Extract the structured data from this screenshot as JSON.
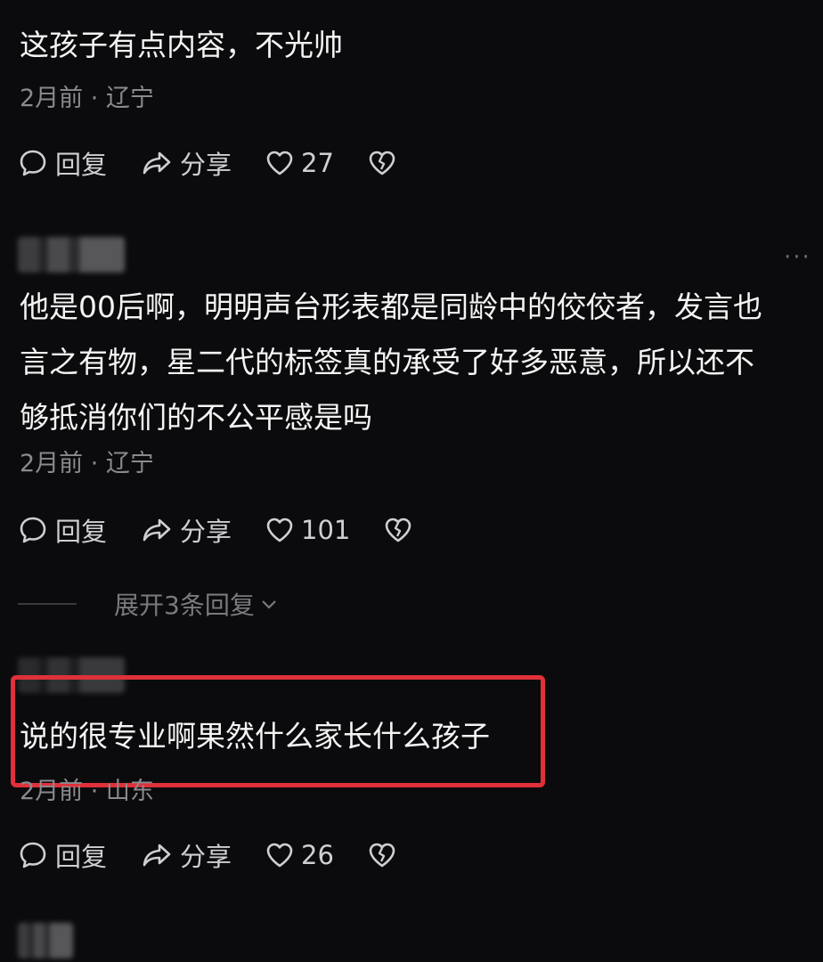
{
  "comments": [
    {
      "text_lines": [
        "这孩子有点内容，不光帅"
      ],
      "meta": "2月前 · 辽宁",
      "reply_label": "回复",
      "share_label": "分享",
      "likes": "27"
    },
    {
      "text_lines": [
        "他是00后啊，明明声台形表都是同龄中的佼佼者，发言也",
        "言之有物，星二代的标签真的承受了好多恶意，所以还不",
        "够抵消你们的不公平感是吗"
      ],
      "meta": "2月前 · 辽宁",
      "reply_label": "回复",
      "share_label": "分享",
      "likes": "101",
      "expand_label": "展开3条回复"
    },
    {
      "text_lines": [
        "说的很专业啊果然什么家长什么孩子"
      ],
      "meta": "2月前 · 山东",
      "reply_label": "回复",
      "share_label": "分享",
      "likes": "26"
    }
  ],
  "more_menu": "···",
  "colors": {
    "background": "#0b0b0d",
    "highlight_border": "#e0303a",
    "meta": "#8a8a8e"
  }
}
